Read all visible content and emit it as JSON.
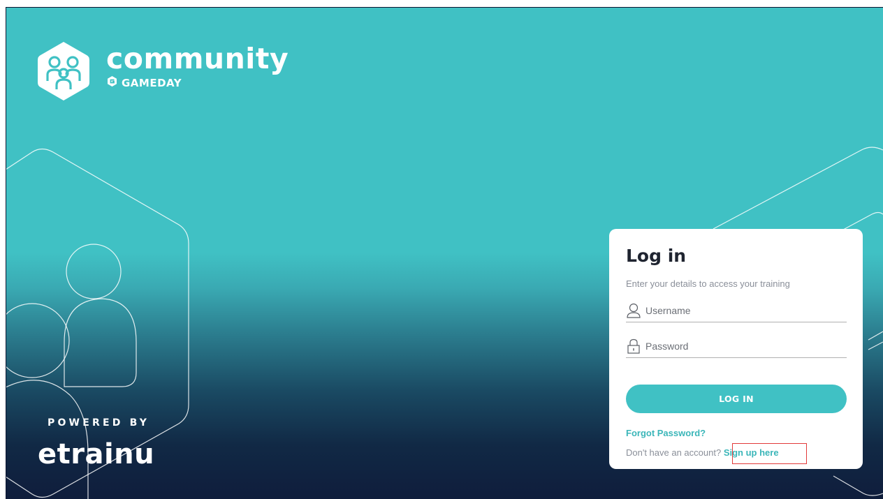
{
  "brand": {
    "title": "community",
    "subtitle": "GAMEDAY",
    "logo_icon": "people-hexagon-icon",
    "sub_icon": "gameday-g-icon"
  },
  "footer": {
    "powered_by": "POWERED BY",
    "provider": "etrainu"
  },
  "login": {
    "title": "Log in",
    "subtitle": "Enter your details to access your training",
    "username": {
      "placeholder": "Username",
      "value": "",
      "icon": "user-icon"
    },
    "password": {
      "placeholder": "Password",
      "value": "",
      "icon": "lock-icon"
    },
    "submit_label": "LOG IN",
    "forgot_label": "Forgot Password?",
    "signup_prompt": "Don't have an account?",
    "signup_link": "Sign up here"
  },
  "colors": {
    "accent": "#40c1c4",
    "link": "#3bb6b9",
    "navy": "#0f1d3c",
    "highlight": "#e23a3a"
  }
}
